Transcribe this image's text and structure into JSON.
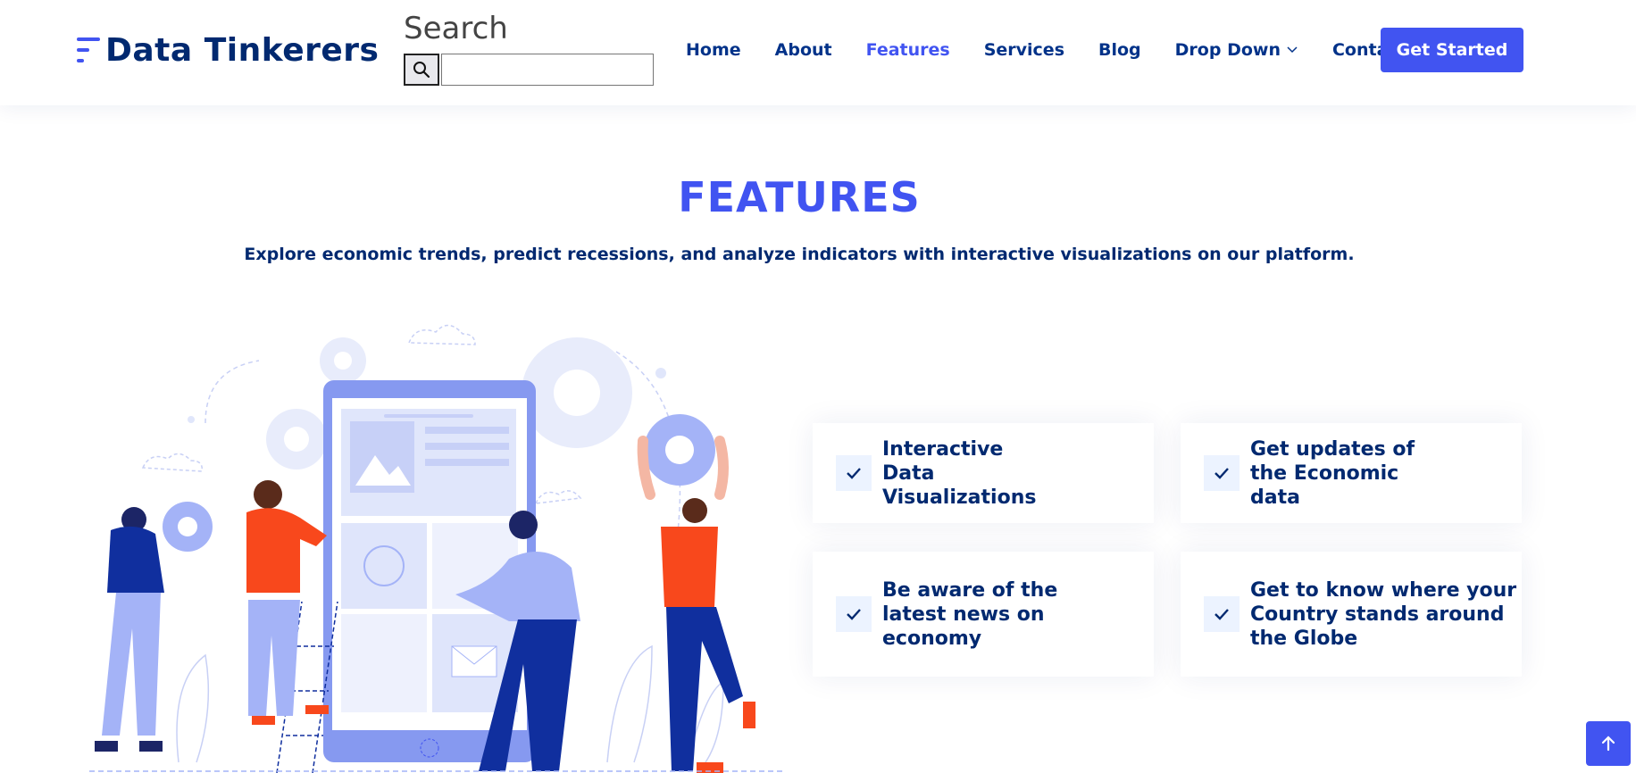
{
  "brand": {
    "name": "Data Tinkerers"
  },
  "search": {
    "title": "Search",
    "value": "",
    "placeholder": ""
  },
  "nav": {
    "items": [
      {
        "label": "Home"
      },
      {
        "label": "About"
      },
      {
        "label": "Features",
        "active": true
      },
      {
        "label": "Services"
      },
      {
        "label": "Blog"
      },
      {
        "label": "Drop Down"
      },
      {
        "label": "Contact"
      }
    ],
    "cta": "Get Started"
  },
  "features": {
    "title": "FEATURES",
    "subtitle": "Explore economic trends, predict recessions, and analyze indicators with interactive visualizations on our platform.",
    "items": [
      {
        "text": "Interactive Data Visualizations"
      },
      {
        "text": "Get updates of the Economic data"
      },
      {
        "text": "Be aware of the latest news on economy"
      },
      {
        "text": "Get to know where your Country stands around the Globe"
      }
    ]
  },
  "colors": {
    "accent": "#4154f1",
    "navy": "#012970",
    "nav_text": "#013289",
    "check_bg": "#ecf3ff",
    "illustration_light": "#e0e6fb",
    "illustration_mid": "#a4b3f7",
    "illustration_orange": "#f8481c",
    "illustration_navy": "#102f9e"
  },
  "icons": {
    "search": "search-icon",
    "chevron": "chevron-down-icon",
    "check": "check-icon",
    "back_to_top": "arrow-up-icon"
  }
}
